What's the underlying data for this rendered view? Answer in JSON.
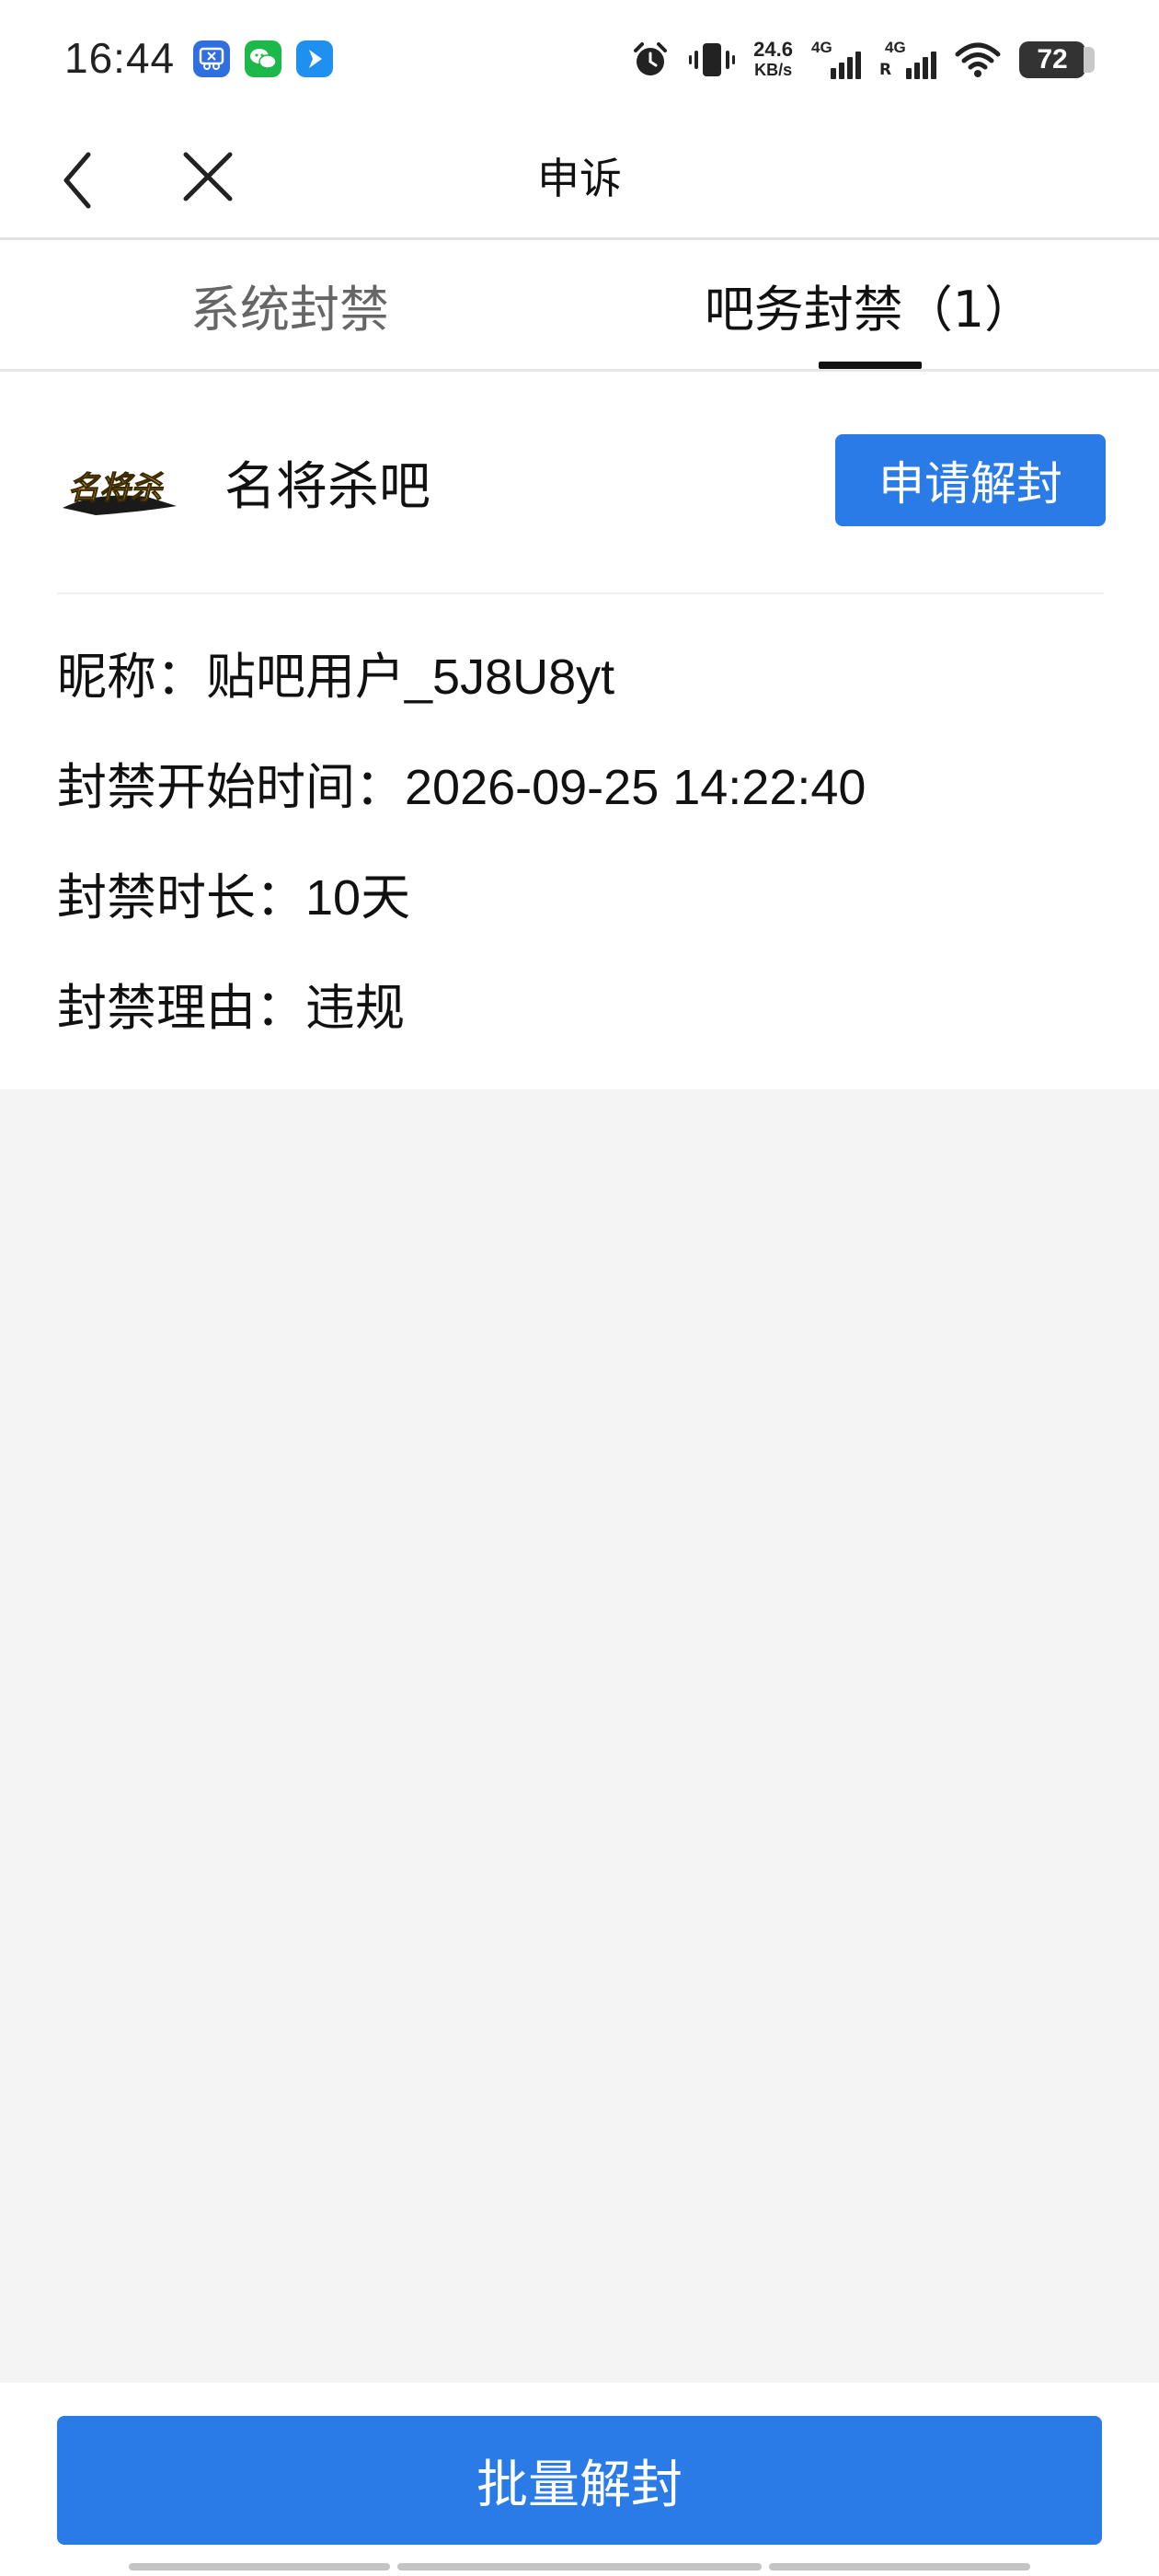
{
  "status_bar": {
    "time": "16:44",
    "net_speed_value": "24.6",
    "net_speed_unit": "KB/s",
    "signal1_label": "4G",
    "signal2_label": "4G",
    "signal2_roaming": "R",
    "battery": "72",
    "icons": [
      "scissors-app-icon",
      "wechat-icon",
      "messenger-app-icon",
      "alarm-icon",
      "vibrate-icon",
      "signal-icon",
      "wifi-icon",
      "battery-icon"
    ]
  },
  "nav": {
    "title": "申诉",
    "back_icon": "chevron-left-icon",
    "close_icon": "close-icon"
  },
  "tabs": [
    {
      "label": "系统封禁",
      "active": false
    },
    {
      "label": "吧务封禁（1）",
      "active": true
    }
  ],
  "ban_item": {
    "forum_logo": "forum-logo-icon",
    "forum_name": "名将杀吧",
    "apply_label": "申请解封",
    "nickname_label": "昵称：",
    "nickname_value": "贴吧用户_5J8U8yt",
    "start_label": "封禁开始时间：",
    "start_value": "2026-09-25 14:22:40",
    "duration_label": "封禁时长：",
    "duration_value": "10天",
    "reason_label": "封禁理由：",
    "reason_value": "违规"
  },
  "bottom": {
    "batch_label": "批量解封"
  },
  "colors": {
    "accent": "#2b7be6",
    "background": "#f4f4f4",
    "card": "#ffffff"
  }
}
